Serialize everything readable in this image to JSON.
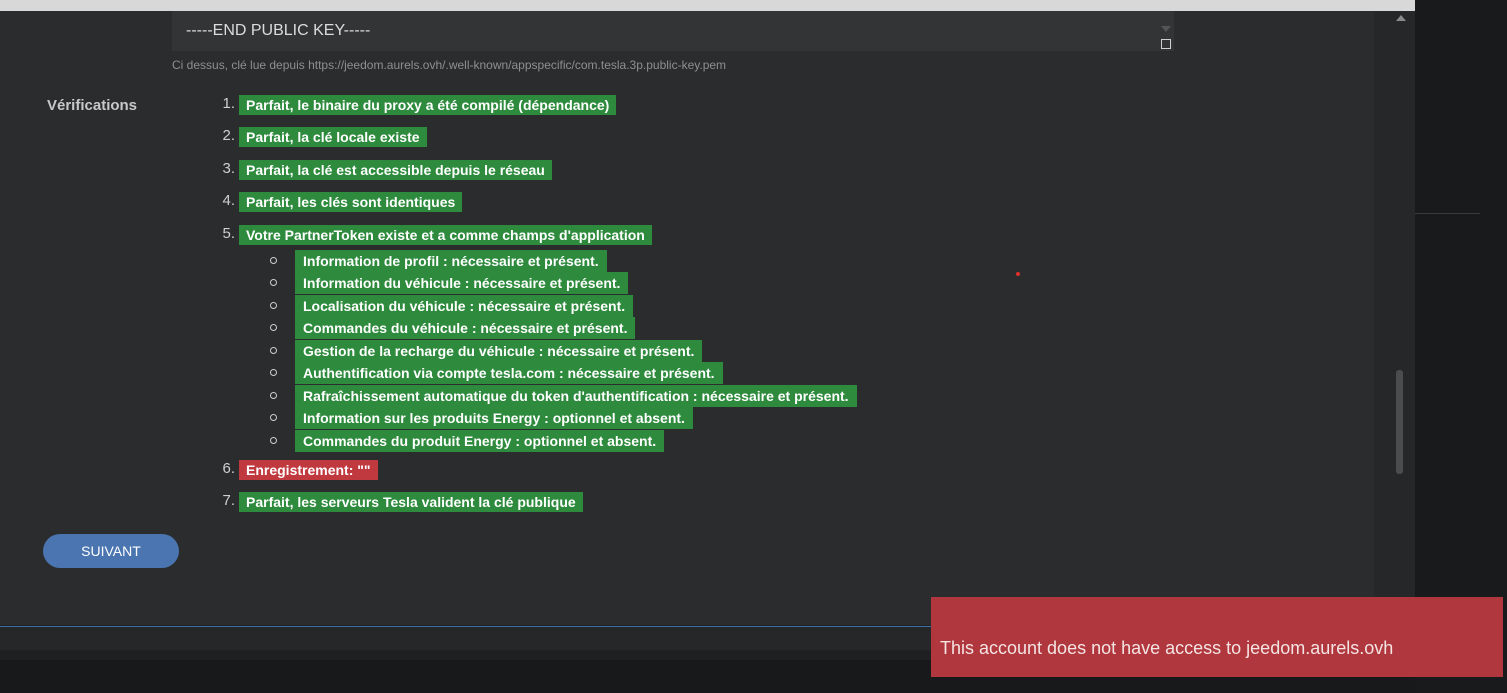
{
  "public_key": {
    "end_line": "-----END PUBLIC KEY-----",
    "source_hint": "Ci dessus, clé lue depuis https://jeedom.aurels.ovh/.well-known/appspecific/com.tesla.3p.public-key.pem"
  },
  "verifications": {
    "label": "Vérifications",
    "items": [
      {
        "num": "1.",
        "text": "Parfait, le binaire du proxy a été compilé (dépendance)",
        "status": "ok"
      },
      {
        "num": "2.",
        "text": "Parfait, la clé locale existe",
        "status": "ok"
      },
      {
        "num": "3.",
        "text": "Parfait, la clé est accessible depuis le réseau",
        "status": "ok"
      },
      {
        "num": "4.",
        "text": "Parfait, les clés sont identiques",
        "status": "ok"
      },
      {
        "num": "5.",
        "text": "Votre PartnerToken existe et a comme champs d'application",
        "status": "ok"
      },
      {
        "num": "6.",
        "text": "Enregistrement: \"\"",
        "status": "error"
      },
      {
        "num": "7.",
        "text": "Parfait, les serveurs Tesla valident la clé publique",
        "status": "ok"
      }
    ],
    "scopes": [
      "Information de profil : nécessaire et présent.",
      "Information du véhicule : nécessaire et présent.",
      "Localisation du véhicule : nécessaire et présent.",
      "Commandes du véhicule : nécessaire et présent.",
      "Gestion de la recharge du véhicule : nécessaire et présent.",
      "Authentification via compte tesla.com : nécessaire et présent.",
      "Rafraîchissement automatique du token d'authentification : nécessaire et présent.",
      "Information sur les produits Energy : optionnel et absent.",
      "Commandes du produit Energy : optionnel et absent."
    ]
  },
  "buttons": {
    "next": "SUIVANT"
  },
  "toast": {
    "message": "This account does not have access to jeedom.aurels.ovh"
  },
  "colors": {
    "ok": "#2e8b3d",
    "error": "#c0393f",
    "button": "#4a75b0",
    "toast": "#b0373d"
  }
}
